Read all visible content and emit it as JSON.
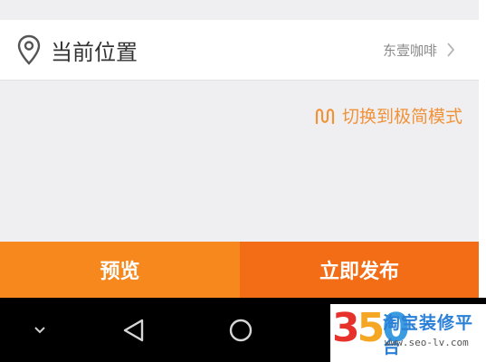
{
  "location": {
    "title": "当前位置",
    "value": "东壹咖啡",
    "icon": "location-pin-icon",
    "chevron_icon": "chevron-right-icon"
  },
  "mode_switch": {
    "label": "切换到极简模式",
    "icon": "switch-wave-icon",
    "color": "#f0923a"
  },
  "actions": {
    "preview_label": "预览",
    "publish_label": "立即发布",
    "preview_color": "#f7881d",
    "publish_color": "#f36d17"
  },
  "system_nav": {
    "icons": [
      "chevron-down-icon",
      "back-triangle-icon",
      "home-circle-icon"
    ]
  },
  "watermark": {
    "logo": "350",
    "text": "淘宝装修平台",
    "url": "www.seo-lv.com"
  }
}
